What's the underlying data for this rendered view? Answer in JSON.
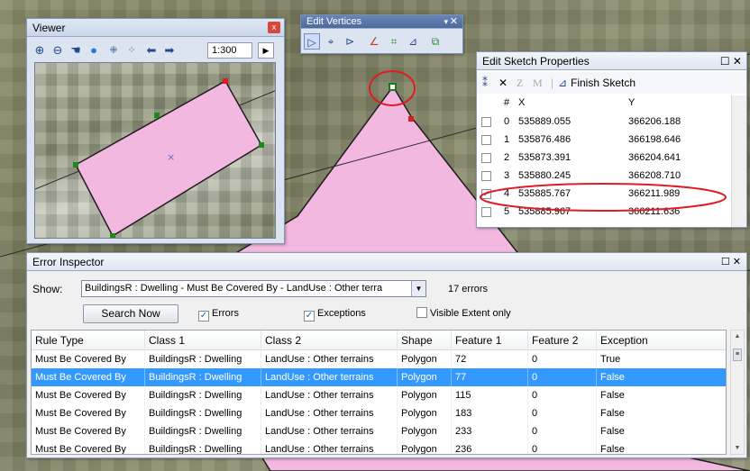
{
  "viewer": {
    "title": "Viewer",
    "close_label": "x",
    "scale": "1:300",
    "tools": [
      "zoom-in-icon",
      "zoom-out-icon",
      "pan-hand-icon",
      "globe-icon",
      "fixed-zoom-in-icon",
      "fixed-zoom-out-icon",
      "back-arrow-icon",
      "forward-arrow-icon"
    ]
  },
  "edit_vertices": {
    "title": "Edit Vertices",
    "pin_label": "▾",
    "close_label": "✕",
    "tools": [
      "select-arrow-icon",
      "modify-sketch-icon",
      "insert-vertex-icon",
      "reshape-icon",
      "continue-icon",
      "finish-sketch-icon",
      "properties-icon"
    ]
  },
  "sketch_properties": {
    "title": "Edit Sketch Properties",
    "close_label": "☐ ✕",
    "toolbar": {
      "delete_label": "✕",
      "z_label": "Z",
      "m_label": "M",
      "finish_label": "Finish Sketch"
    },
    "columns": [
      "#",
      "X",
      "Y"
    ],
    "rows": [
      {
        "n": "0",
        "x": "535889.055",
        "y": "366206.188",
        "checked": false
      },
      {
        "n": "1",
        "x": "535876.486",
        "y": "366198.646",
        "checked": false
      },
      {
        "n": "2",
        "x": "535873.391",
        "y": "366204.641",
        "checked": false
      },
      {
        "n": "3",
        "x": "535880.245",
        "y": "366208.710",
        "checked": false
      },
      {
        "n": "4",
        "x": "535885.767",
        "y": "366211.989",
        "checked": true
      },
      {
        "n": "5",
        "x": "535885.967",
        "y": "366211.636",
        "checked": false
      }
    ]
  },
  "error_inspector": {
    "title": "Error Inspector",
    "win_buttons": "☐ ✕",
    "show_label": "Show:",
    "show_value": "BuildingsR : Dwelling - Must Be Covered By - LandUse : Other terra",
    "error_count": "17 errors",
    "search_button": "Search Now",
    "chk_errors": "Errors",
    "chk_exceptions": "Exceptions",
    "chk_visible": "Visible Extent only",
    "columns": [
      "Rule Type",
      "Class 1",
      "Class 2",
      "Shape",
      "Feature 1",
      "Feature 2",
      "Exception"
    ],
    "rows": [
      [
        "Must Be Covered By",
        "BuildingsR : Dwelling",
        "LandUse : Other terrains",
        "Polygon",
        "72",
        "0",
        "True"
      ],
      [
        "Must Be Covered By",
        "BuildingsR : Dwelling",
        "LandUse : Other terrains",
        "Polygon",
        "77",
        "0",
        "False"
      ],
      [
        "Must Be Covered By",
        "BuildingsR : Dwelling",
        "LandUse : Other terrains",
        "Polygon",
        "115",
        "0",
        "False"
      ],
      [
        "Must Be Covered By",
        "BuildingsR : Dwelling",
        "LandUse : Other terrains",
        "Polygon",
        "183",
        "0",
        "False"
      ],
      [
        "Must Be Covered By",
        "BuildingsR : Dwelling",
        "LandUse : Other terrains",
        "Polygon",
        "233",
        "0",
        "False"
      ],
      [
        "Must Be Covered By",
        "BuildingsR : Dwelling",
        "LandUse : Other terrains",
        "Polygon",
        "236",
        "0",
        "False"
      ]
    ],
    "selected_row": 1
  },
  "colors": {
    "polygon_fill": "#f2b8e0",
    "highlight_circle": "#e01b24",
    "selection": "#3399ff"
  }
}
